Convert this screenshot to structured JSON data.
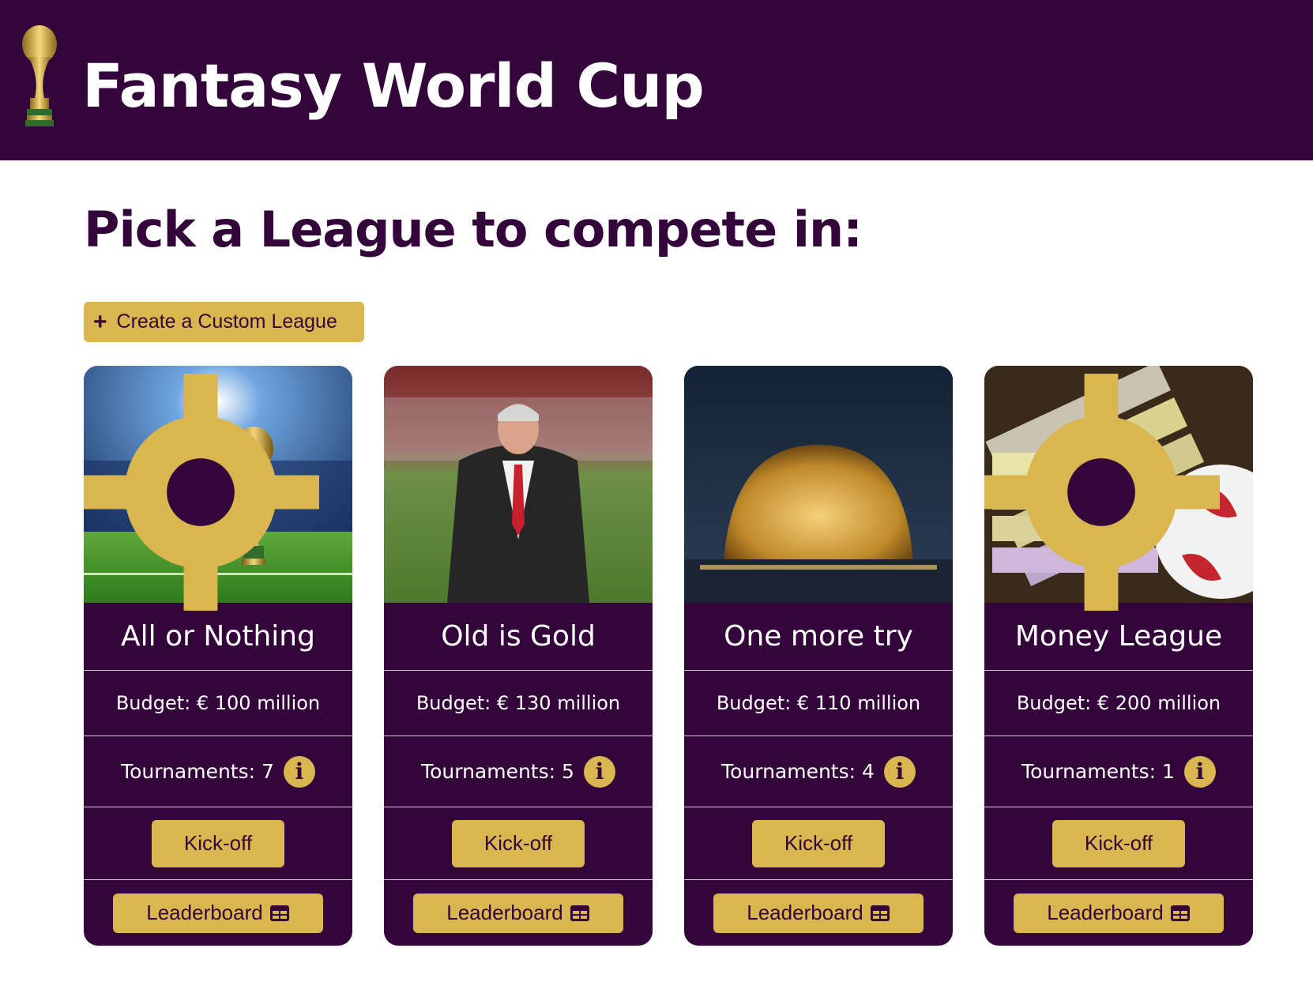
{
  "header": {
    "title": "Fantasy World Cup",
    "logo_icon": "trophy-icon"
  },
  "main": {
    "heading": "Pick a League to compete in:",
    "create_button": {
      "icon": "plus-icon",
      "label": "Create a Custom League"
    }
  },
  "leagues": [
    {
      "name": "All or Nothing",
      "image": "trophy-in-stadium",
      "budget": "Budget: € 100 million",
      "tournaments": "Tournaments: 7",
      "kickoff_label": "Kick-off",
      "leaderboard_label": "Leaderboard"
    },
    {
      "name": "Old is Gold",
      "image": "manager-on-pitch",
      "budget": "Budget: € 130 million",
      "tournaments": "Tournaments: 5",
      "kickoff_label": "Kick-off",
      "leaderboard_label": "Leaderboard"
    },
    {
      "name": "One more try",
      "image": "golden-stadium-at-night",
      "budget": "Budget: € 110 million",
      "tournaments": "Tournaments: 4",
      "kickoff_label": "Kick-off",
      "leaderboard_label": "Leaderboard"
    },
    {
      "name": "Money League",
      "image": "euro-banknotes-and-ball",
      "budget": "Budget: € 200 million",
      "tournaments": "Tournaments: 1",
      "kickoff_label": "Kick-off",
      "leaderboard_label": "Leaderboard"
    }
  ],
  "colors": {
    "primary": "#33053b",
    "accent": "#d9b650",
    "background": "#ffffff"
  }
}
